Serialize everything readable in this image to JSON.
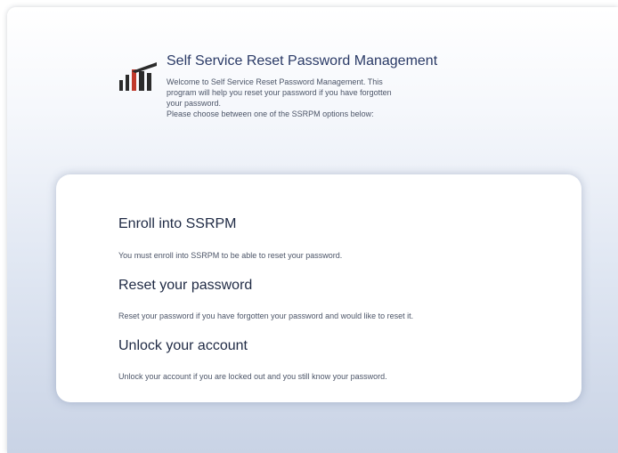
{
  "header": {
    "title": "Self Service Reset Password Management",
    "description_lines": [
      "Welcome to Self Service Reset Password Management. This",
      "program will help you reset your password if you have forgotten",
      "your password.",
      "Please choose between one of the SSRPM options below:"
    ],
    "logo_icon": "ssrpm-logo-icon"
  },
  "options": [
    {
      "title": "Enroll into SSRPM",
      "description": "You must enroll into SSRPM to be able to reset your password."
    },
    {
      "title": "Reset your password",
      "description": "Reset your password if you have forgotten your password and would like to reset it."
    },
    {
      "title": "Unlock your account",
      "description": "Unlock your account if you are locked out and you still know your password."
    }
  ],
  "colors": {
    "title": "#2a3a66",
    "text": "#4c5568",
    "logo_dark": "#2b2b2b",
    "logo_red": "#c0392b"
  }
}
